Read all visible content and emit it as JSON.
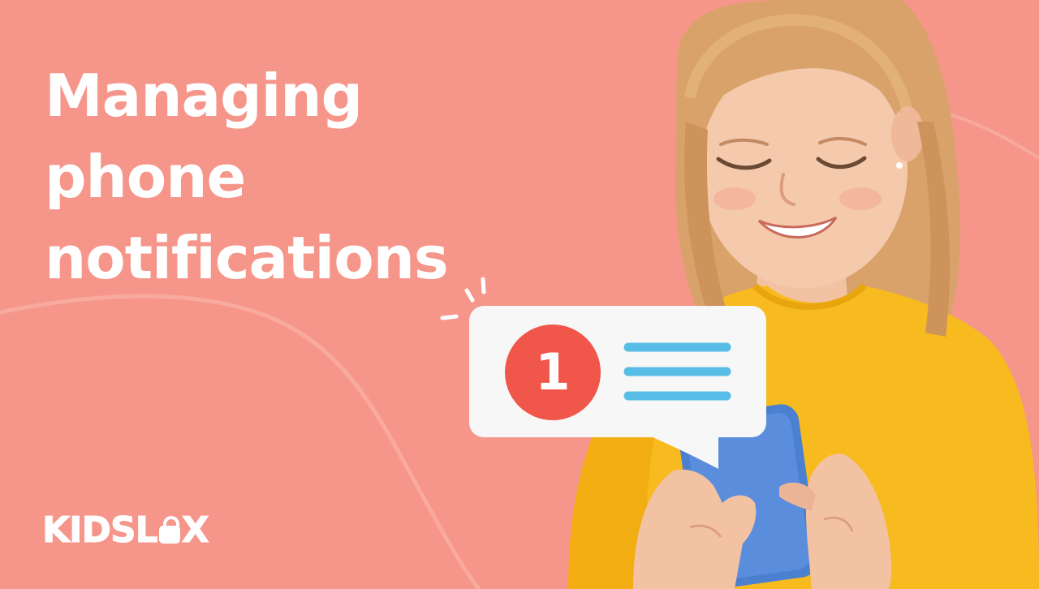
{
  "headline": {
    "line1": "Managing",
    "line2": "phone",
    "line3": "notifications"
  },
  "notification": {
    "count": "1",
    "badge_color": "#f0564a",
    "line_color": "#58bde6"
  },
  "brand": {
    "part1": "KIDSL",
    "part2": "X",
    "logo_icon": "padlock-icon"
  },
  "colors": {
    "background": "#f6968a",
    "text": "#ffffff",
    "shirt": "#f7bb1f",
    "phone": "#4b7fcf"
  },
  "illustration": "smiling-girl-holding-phone"
}
